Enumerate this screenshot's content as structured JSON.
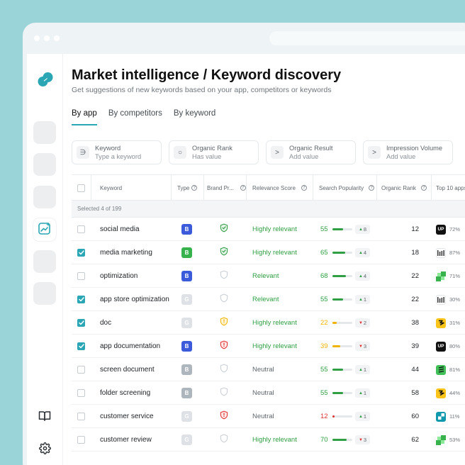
{
  "page": {
    "title": "Market intelligence / Keyword discovery",
    "subtitle": "Get suggestions of new keywords based on your app, competitors or keywords"
  },
  "tabs": [
    {
      "label": "By app",
      "active": true
    },
    {
      "label": "By competitors",
      "active": false
    },
    {
      "label": "By keyword",
      "active": false
    }
  ],
  "filters": [
    {
      "icon": "∋",
      "label": "Keyword",
      "value": "Type a keyword"
    },
    {
      "icon": "○",
      "label": "Organic Rank",
      "value": "Has value"
    },
    {
      "icon": ">",
      "label": "Organic Result",
      "value": "Add value"
    },
    {
      "icon": ">",
      "label": "Impression Volume",
      "value": "Add value"
    }
  ],
  "table": {
    "columns": {
      "keyword": "Keyword",
      "type": "Type",
      "brand": "Brand Pr...",
      "relevance": "Relevance Score",
      "popularity": "Search Popularity",
      "rank": "Organic Rank",
      "top": "Top 10 apps"
    },
    "selected_text": "Selected 4 of 199",
    "rows": [
      {
        "checked": false,
        "keyword": "social media",
        "type": "B",
        "type_style": "blue",
        "shield": "green-check",
        "relevance": "Highly relevant",
        "rel_color": "#2f9e44",
        "pop": "55",
        "pop_level": 0.55,
        "pop_color": "#2f9e44",
        "change": "8",
        "change_dir": "up",
        "rank": "12",
        "app": "up",
        "pct": "72%"
      },
      {
        "checked": true,
        "keyword": "media marketing",
        "type": "B",
        "type_style": "green",
        "shield": "green-check",
        "relevance": "Highly relevant",
        "rel_color": "#2f9e44",
        "pop": "65",
        "pop_level": 0.65,
        "pop_color": "#2f9e44",
        "change": "4",
        "change_dir": "up",
        "rank": "18",
        "app": "bars",
        "pct": "87%"
      },
      {
        "checked": false,
        "keyword": "optimization",
        "type": "B",
        "type_style": "blue",
        "shield": "empty",
        "relevance": "Relevant",
        "rel_color": "#2f9e44",
        "pop": "68",
        "pop_level": 0.68,
        "pop_color": "#2f9e44",
        "change": "4",
        "change_dir": "up",
        "rank": "22",
        "app": "green-squares",
        "pct": "71%"
      },
      {
        "checked": true,
        "keyword": "app store optimization",
        "type": "G",
        "type_style": "gray-light",
        "shield": "empty",
        "relevance": "Relevant",
        "rel_color": "#2f9e44",
        "pop": "55",
        "pop_level": 0.55,
        "pop_color": "#2f9e44",
        "change": "1",
        "change_dir": "up",
        "rank": "22",
        "app": "bars",
        "pct": "30%"
      },
      {
        "checked": true,
        "keyword": "doc",
        "type": "G",
        "type_style": "gray-light",
        "shield": "yellow",
        "relevance": "Highly relevant",
        "rel_color": "#2f9e44",
        "pop": "22",
        "pop_level": 0.22,
        "pop_color": "#f0b400",
        "change": "2",
        "change_dir": "down",
        "rank": "38",
        "app": "yellow",
        "pct": "31%"
      },
      {
        "checked": true,
        "keyword": "app documentation",
        "type": "B",
        "type_style": "blue",
        "shield": "red",
        "relevance": "Highly relevant",
        "rel_color": "#2f9e44",
        "pop": "39",
        "pop_level": 0.39,
        "pop_color": "#f0b400",
        "change": "3",
        "change_dir": "down",
        "rank": "39",
        "app": "up",
        "pct": "80%"
      },
      {
        "checked": false,
        "keyword": "screen document",
        "type": "B",
        "type_style": "gray",
        "shield": "empty",
        "relevance": "Neutral",
        "rel_color": "#5f666d",
        "pop": "55",
        "pop_level": 0.55,
        "pop_color": "#2f9e44",
        "change": "1",
        "change_dir": "up",
        "rank": "44",
        "app": "green-stack",
        "pct": "81%"
      },
      {
        "checked": false,
        "keyword": "folder screening",
        "type": "B",
        "type_style": "gray",
        "shield": "empty",
        "relevance": "Neutral",
        "rel_color": "#5f666d",
        "pop": "55",
        "pop_level": 0.55,
        "pop_color": "#2f9e44",
        "change": "1",
        "change_dir": "up",
        "rank": "58",
        "app": "yellow",
        "pct": "44%"
      },
      {
        "checked": false,
        "keyword": "customer service",
        "type": "G",
        "type_style": "gray-light",
        "shield": "red",
        "relevance": "Neutral",
        "rel_color": "#5f666d",
        "pop": "12",
        "pop_level": 0.12,
        "pop_color": "#e03131",
        "change": "1",
        "change_dir": "up",
        "rank": "60",
        "app": "teal",
        "pct": "11%"
      },
      {
        "checked": false,
        "keyword": "customer review",
        "type": "G",
        "type_style": "gray-light",
        "shield": "empty",
        "relevance": "Highly relevant",
        "rel_color": "#2f9e44",
        "pop": "70",
        "pop_level": 0.7,
        "pop_color": "#2f9e44",
        "change": "3",
        "change_dir": "down",
        "rank": "62",
        "app": "green-squares",
        "pct": "53%"
      }
    ]
  },
  "colors": {
    "accent": "#2aa6b4",
    "blue_badge": "#3b5bdb",
    "green_badge": "#37b24d",
    "gray_badge": "#adb5bd",
    "gray_light_badge": "#dee2e6",
    "up": "#2f9e44",
    "down": "#e03131"
  },
  "icons": {
    "logo": "brand-logo-icon",
    "sidebar_active": "sparkle-chart-icon",
    "sidebar_book": "book-icon",
    "sidebar_settings": "gear-icon"
  }
}
